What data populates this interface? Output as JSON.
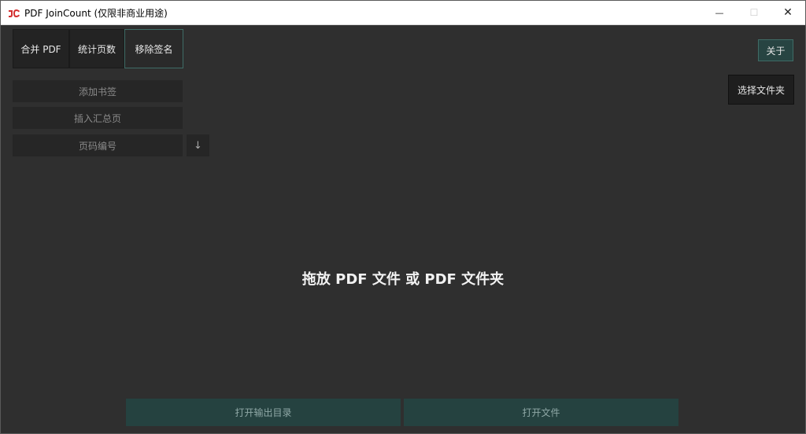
{
  "window": {
    "title": "PDF JoinCount (仅限非商业用途)",
    "icon": "jc-logo-icon",
    "controls": {
      "minimize": "—",
      "maximize": "☐",
      "close": "✕"
    }
  },
  "tabs": [
    {
      "label": "合并 PDF",
      "active": false
    },
    {
      "label": "统计页数",
      "active": false
    },
    {
      "label": "移除签名",
      "active": true
    }
  ],
  "options": {
    "add_bookmarks": "添加书签",
    "insert_summary": "插入汇总页",
    "page_numbering": "页码编号",
    "page_numbering_arrow": "↓"
  },
  "header_actions": {
    "about": "关于",
    "select_folder": "选择文件夹"
  },
  "drop_zone": {
    "text": "拖放 PDF 文件 或 PDF 文件夹"
  },
  "footer": {
    "open_output_dir": "打开输出目录",
    "open_file": "打开文件"
  },
  "colors": {
    "background": "#2f2f2f",
    "accent": "#274442",
    "accent_border": "#3f6c66",
    "logo_red": "#d32f2f"
  }
}
